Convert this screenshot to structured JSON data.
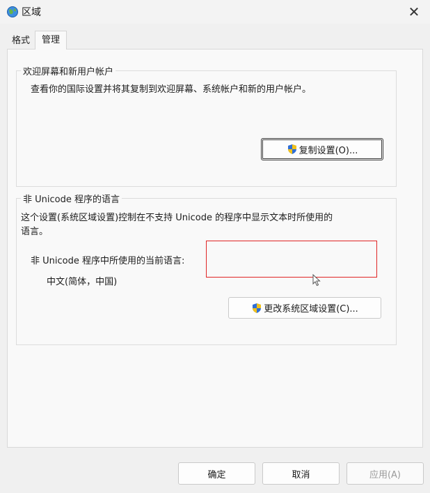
{
  "window": {
    "title": "区域",
    "close_label": "✕"
  },
  "tabs": [
    {
      "label": "格式"
    },
    {
      "label": "管理"
    }
  ],
  "welcome_group": {
    "legend": "欢迎屏幕和新用户帐户",
    "description": "查看你的国际设置并将其复制到欢迎屏幕、系统帐户和新的用户帐户。",
    "copy_button": "复制设置(O)..."
  },
  "unicode_group": {
    "legend": "非 Unicode 程序的语言",
    "description_line1": "这个设置(系统区域设置)控制在不支持 Unicode 的程序中显示文本时所使用的",
    "description_line2": "语言。",
    "current_label": "非 Unicode 程序中所使用的当前语言:",
    "current_value": "中文(简体，中国)",
    "change_button": "更改系统区域设置(C)..."
  },
  "footer": {
    "ok": "确定",
    "cancel": "取消",
    "apply": "应用(A)"
  },
  "colors": {
    "highlight": "#e02424",
    "shield_blue": "#2f6fd6",
    "shield_yellow": "#f2c21b"
  }
}
